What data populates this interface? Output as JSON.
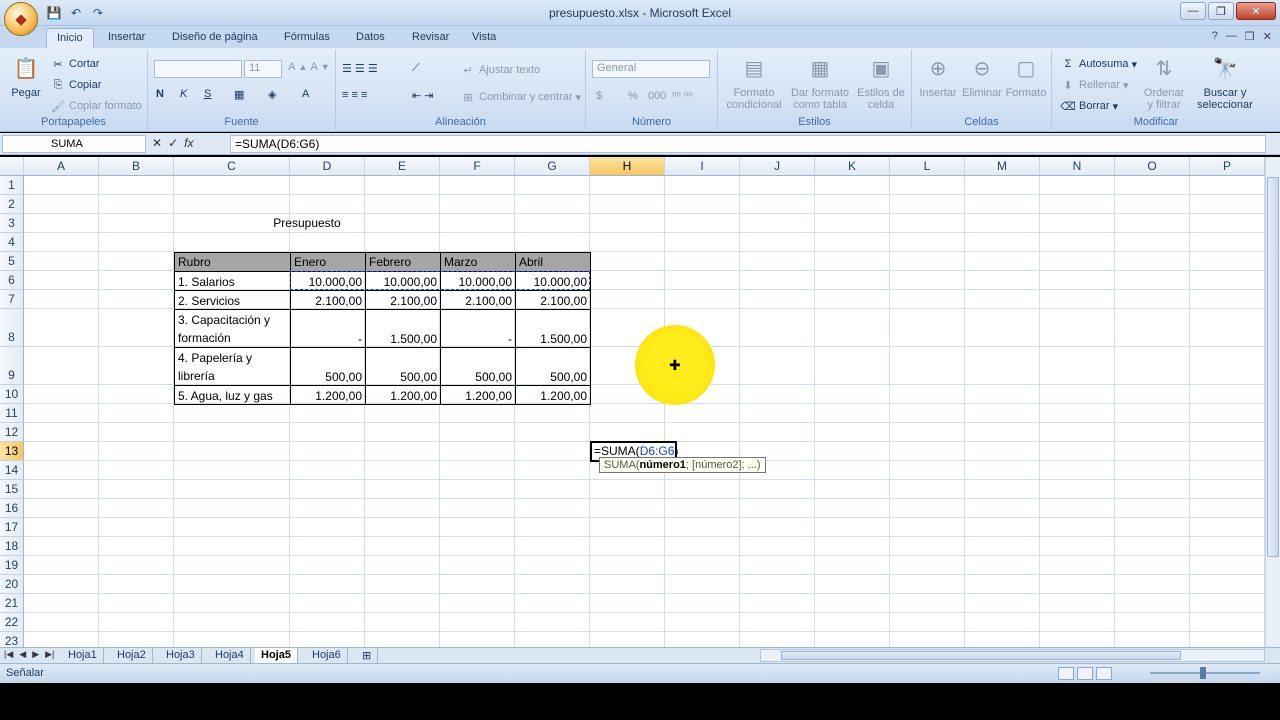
{
  "window": {
    "title": "presupuesto.xlsx - Microsoft Excel",
    "controls": [
      "—",
      "❐",
      "✕"
    ]
  },
  "qat": [
    "💾",
    "↶",
    "↷"
  ],
  "tabs": [
    "Inicio",
    "Insertar",
    "Diseño de página",
    "Fórmulas",
    "Datos",
    "Revisar",
    "Vista"
  ],
  "ribbon": {
    "portapapeles": {
      "label": "Portapapeles",
      "pegar": "Pegar",
      "cortar": "Cortar",
      "copiar": "Copiar",
      "copiar_formato": "Copiar formato"
    },
    "fuente": {
      "label": "Fuente",
      "size": "11",
      "bold": "N",
      "italic": "K",
      "underline": "S"
    },
    "alineacion": {
      "label": "Alineación",
      "ajustar": "Ajustar texto",
      "combinar": "Combinar y centrar"
    },
    "numero": {
      "label": "Número",
      "format": "General",
      "currency": "$",
      "percent": "%",
      "thousands": "000"
    },
    "estilos": {
      "label": "Estilos",
      "formato_condicional": [
        "Formato",
        "condicional"
      ],
      "dar_formato": [
        "Dar formato",
        "como tabla"
      ],
      "estilos_celda": [
        "Estilos de",
        "celda"
      ]
    },
    "celdas": {
      "label": "Celdas",
      "insertar": "Insertar",
      "eliminar": "Eliminar",
      "formato": "Formato"
    },
    "modificar": {
      "label": "Modificar",
      "autosuma": "Autosuma",
      "rellenar": "Rellenar",
      "borrar": "Borrar",
      "ordenar": [
        "Ordenar",
        "y filtrar"
      ],
      "buscar": [
        "Buscar y",
        "seleccionar"
      ]
    }
  },
  "formula_bar": {
    "name_box": "SUMA",
    "formula": "=SUMA(D6:G6)"
  },
  "columns": [
    "A",
    "B",
    "C",
    "D",
    "E",
    "F",
    "G",
    "H",
    "I",
    "J",
    "K",
    "L",
    "M",
    "N",
    "O",
    "P"
  ],
  "rows": [
    "1",
    "2",
    "3",
    "4",
    "5",
    "6",
    "7",
    "8",
    "9",
    "10",
    "11",
    "12",
    "13",
    "14",
    "15",
    "16",
    "17",
    "18",
    "19",
    "20",
    "21",
    "22",
    "23"
  ],
  "sheet": {
    "title": "Presupuesto",
    "headers": [
      "Rubro",
      "Enero",
      "Febrero",
      "Marzo",
      "Abril"
    ],
    "data": [
      {
        "rubro": [
          "1. Salarios"
        ],
        "values": [
          "10.000,00",
          "10.000,00",
          "10.000,00",
          "10.000,00"
        ]
      },
      {
        "rubro": [
          "2. Servicios"
        ],
        "values": [
          "2.100,00",
          "2.100,00",
          "2.100,00",
          "2.100,00"
        ]
      },
      {
        "rubro": [
          "3. Capacitación y",
          "formación"
        ],
        "values": [
          "-",
          "1.500,00",
          "-",
          "1.500,00"
        ]
      },
      {
        "rubro": [
          "4. Papelería y",
          "librería"
        ],
        "values": [
          "500,00",
          "500,00",
          "500,00",
          "500,00"
        ]
      },
      {
        "rubro": [
          "5. Agua, luz y gas"
        ],
        "values": [
          "1.200,00",
          "1.200,00",
          "1.200,00",
          "1.200,00"
        ]
      }
    ],
    "edit_cell": {
      "prefix": "=SUMA(",
      "ref": "D6:G6",
      "suffix": ")"
    },
    "tooltip": {
      "fn": "SUMA(",
      "arg1": "número1",
      "rest": "; [número2]; ...)"
    }
  },
  "sheet_tabs": [
    "Hoja1",
    "Hoja2",
    "Hoja3",
    "Hoja4",
    "Hoja5",
    "Hoja6"
  ],
  "active_sheet": "Hoja5",
  "status": {
    "mode": "Señalar"
  }
}
